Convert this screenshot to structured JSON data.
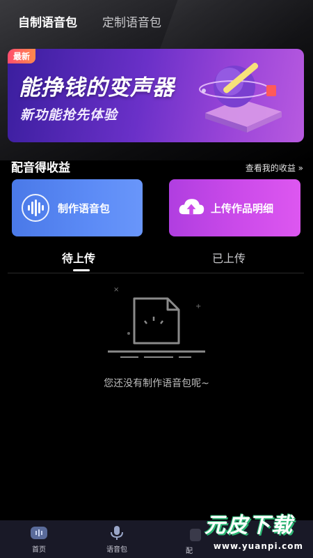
{
  "header": {
    "tabs": [
      {
        "label": "自制语音包",
        "active": true
      },
      {
        "label": "定制语音包",
        "active": false
      }
    ]
  },
  "banner": {
    "badge": "最新",
    "title": "能挣钱的变声器",
    "subtitle": "新功能抢先体验"
  },
  "earnings": {
    "title": "配音得收益",
    "link": "查看我的收益 »"
  },
  "cards": [
    {
      "label": "制作语音包",
      "icon": "waveform-icon"
    },
    {
      "label": "上传作品明细",
      "icon": "cloud-upload-icon"
    }
  ],
  "subtabs": [
    {
      "label": "待上传",
      "active": true
    },
    {
      "label": "已上传",
      "active": false
    }
  ],
  "empty": {
    "text": "您还没有制作语音包呢~"
  },
  "bottom_nav": {
    "items": [
      {
        "label": "首页",
        "icon": "home-icon"
      },
      {
        "label": "语音包",
        "icon": "mic-icon"
      },
      {
        "label": "配",
        "icon": "partial-icon"
      }
    ]
  },
  "watermark": {
    "main": "元皮下载",
    "url": "www.yuanpi.com"
  },
  "colors": {
    "card_make": "#5c8bf6",
    "card_upload": "#cc4bea",
    "banner_start": "#3a1e9e",
    "banner_end": "#b85ae0",
    "nav_bg": "#191927"
  }
}
